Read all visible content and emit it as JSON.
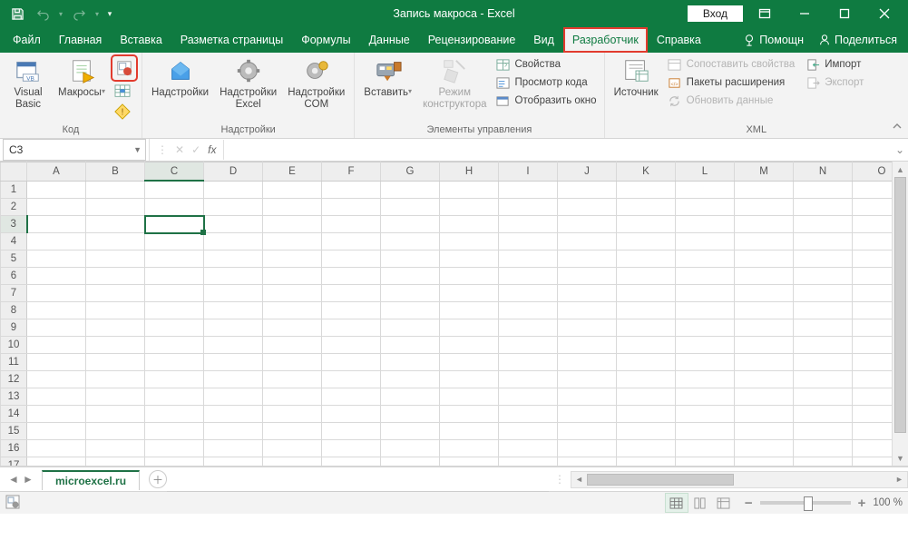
{
  "titlebar": {
    "title": "Запись макроса  -  Excel",
    "signin": "Вход"
  },
  "tabs": {
    "file": "Файл",
    "home": "Главная",
    "insert": "Вставка",
    "layout": "Разметка страницы",
    "formulas": "Формулы",
    "data": "Данные",
    "review": "Рецензирование",
    "view": "Вид",
    "developer": "Разработчик",
    "help": "Справка",
    "assist": "Помощн",
    "share": "Поделиться"
  },
  "ribbon": {
    "code": {
      "visualbasic": "Visual\nBasic",
      "macros": "Макросы",
      "group": "Код"
    },
    "addins": {
      "addins": "Надстройки",
      "exceladdins": "Надстройки\nExcel",
      "comaddins": "Надстройки\nCOM",
      "group": "Надстройки"
    },
    "controls": {
      "insert": "Вставить",
      "design": "Режим\nконструктора",
      "props": "Свойства",
      "viewcode": "Просмотр кода",
      "showwin": "Отобразить окно",
      "group": "Элементы управления"
    },
    "xml": {
      "source": "Источник",
      "mapprops": "Сопоставить свойства",
      "expansion": "Пакеты расширения",
      "refresh": "Обновить данные",
      "import": "Импорт",
      "export": "Экспорт",
      "group": "XML"
    }
  },
  "namebox": "C3",
  "columns": [
    "A",
    "B",
    "C",
    "D",
    "E",
    "F",
    "G",
    "H",
    "I",
    "J",
    "K",
    "L",
    "M",
    "N",
    "O"
  ],
  "rows": [
    "1",
    "2",
    "3",
    "4",
    "5",
    "6",
    "7",
    "8",
    "9",
    "10",
    "11",
    "12",
    "13",
    "14",
    "15",
    "16",
    "17"
  ],
  "selected": {
    "col": "C",
    "row": "3"
  },
  "sheet": "microexcel.ru",
  "zoom": "100 %"
}
